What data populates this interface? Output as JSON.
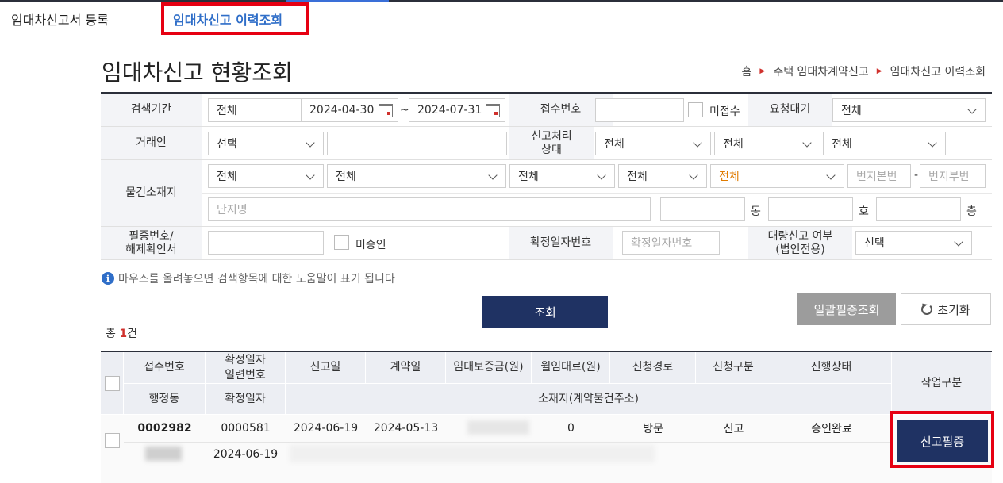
{
  "tabs": [
    {
      "label": "임대차신고서 등록"
    },
    {
      "label": "임대차신고 이력조회"
    }
  ],
  "page_title": "임대차신고 현황조회",
  "breadcrumb": [
    "홈",
    "주택 임대차계약신고",
    "임대차신고 이력조회"
  ],
  "search": {
    "period": {
      "label": "검색기간",
      "type_value": "전체",
      "start_date": "2024-04-30",
      "tilde": "~",
      "end_date": "2024-07-31"
    },
    "receipt_no": {
      "label": "접수번호",
      "value": "",
      "unreceived_label": "미접수"
    },
    "request_wait": {
      "label": "요청대기",
      "value": "전체"
    },
    "party": {
      "label": "거래인",
      "value": "선택",
      "input": ""
    },
    "process_status": {
      "label": "신고처리\n상태",
      "values": [
        "전체",
        "전체",
        "전체"
      ]
    },
    "location": {
      "label": "물건소재지",
      "selects": [
        "전체",
        "전체",
        "전체",
        "전체",
        "전체"
      ],
      "lot_main_placeholder": "번지본번",
      "dash": "-",
      "lot_sub_placeholder": "번지부번",
      "complex_placeholder": "단지명",
      "dong_label": "동",
      "ho_label": "호",
      "floor_label": "층"
    },
    "cert_no": {
      "label": "필증번호/\n해제확인서",
      "unapproved_label": "미승인"
    },
    "confirm_no": {
      "label": "확정일자번호",
      "placeholder": "확정일자번호"
    },
    "bulk_report": {
      "label": "대량신고 여부\n(법인전용)",
      "value": "선택"
    }
  },
  "help_text": "마우스를 올려놓으면 검색항목에 대한 도움말이 표기 됩니다",
  "buttons": {
    "search": "조회",
    "bulk_cert": "일괄필증조회",
    "reset": "초기화"
  },
  "total": {
    "prefix": "총",
    "count": "1",
    "suffix": "건"
  },
  "table": {
    "headers_row1": [
      "접수번호",
      "확정일자\n일련번호",
      "신고일",
      "계약일",
      "임대보증금(원)",
      "월임대료(원)",
      "신청경로",
      "신청구분",
      "진행상태"
    ],
    "headers_row2": [
      "행정동",
      "확정일자",
      "소재지(계약물건주소)"
    ],
    "work_header": "작업구분",
    "rows": [
      {
        "receipt_no": "0002982",
        "serial_no": "0000581",
        "report_date": "2024-06-19",
        "contract_date": "2024-05-13",
        "deposit": "",
        "monthly_rent": "0",
        "channel": "방문",
        "request_type": "신고",
        "status": "승인완료",
        "admin_dong": "",
        "confirm_date": "2024-06-19",
        "address": "",
        "action": "신고필증"
      }
    ]
  },
  "colors": {
    "navy": "#1f3263",
    "highlight": "#e60012",
    "accent": "#2f6ec8",
    "count": "#d0312d"
  }
}
